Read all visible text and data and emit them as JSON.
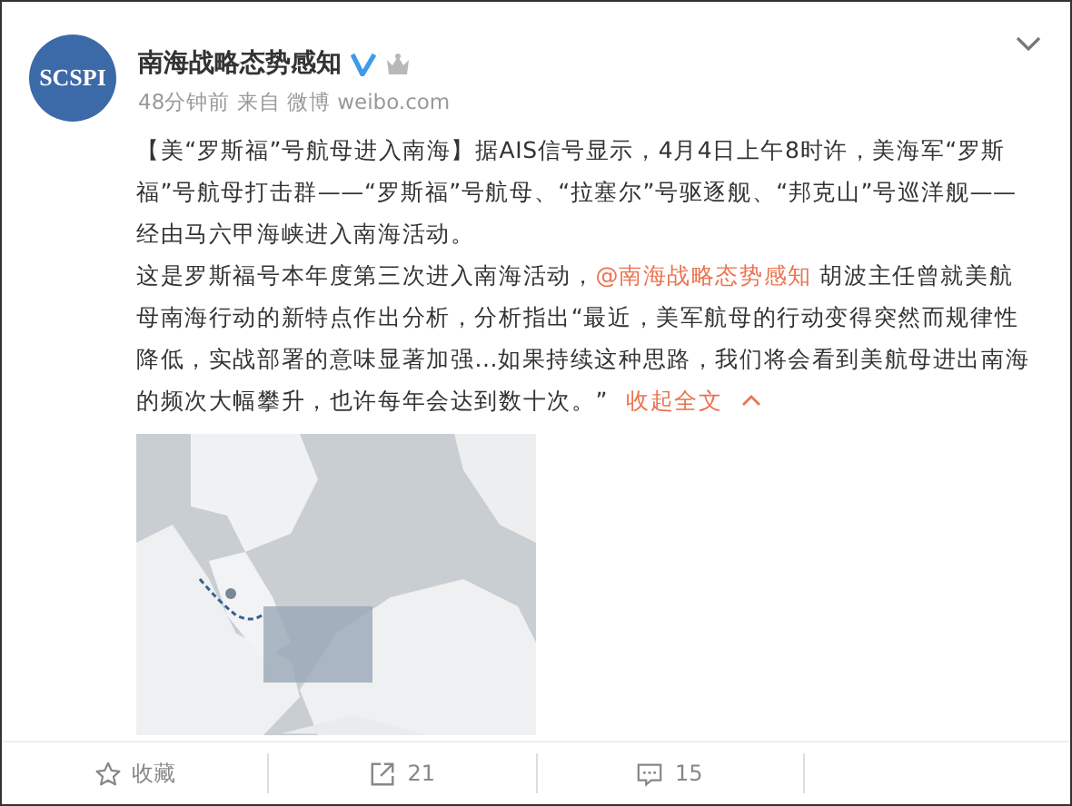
{
  "post": {
    "avatar_text": "SCSPI",
    "author": "南海战略态势感知",
    "meta": "48分钟前 来自 微博 weibo.com",
    "paragraph_1": "【美“罗斯福”号航母进入南海】据AIS信号显示，4月4日上午8时许，美海军“罗斯福”号航母打击群——“罗斯福”号航母、“拉塞尔”号驱逐舰、“邦克山”号巡洋舰——经由马六甲海峡进入南海活动。",
    "paragraph_2_before": "这是罗斯福号本年度第三次进入南海活动，",
    "mention": "@南海战略态势感知",
    "paragraph_2_after": " 胡波主任曾就美航母南海行动的新特点作出分析，分析指出“最近，美军航母的行动变得突然而规律性降低，实战部署的意味显著加强...如果持续这种思路，我们将会看到美航母进出南海的频次大幅攀升，也许每年会达到数十次。”",
    "collapse_link": "收起全文"
  },
  "actions": [
    {
      "kind": "favorite",
      "label": "收藏"
    },
    {
      "kind": "repost",
      "label": "21"
    },
    {
      "kind": "comment",
      "label": "15"
    }
  ]
}
